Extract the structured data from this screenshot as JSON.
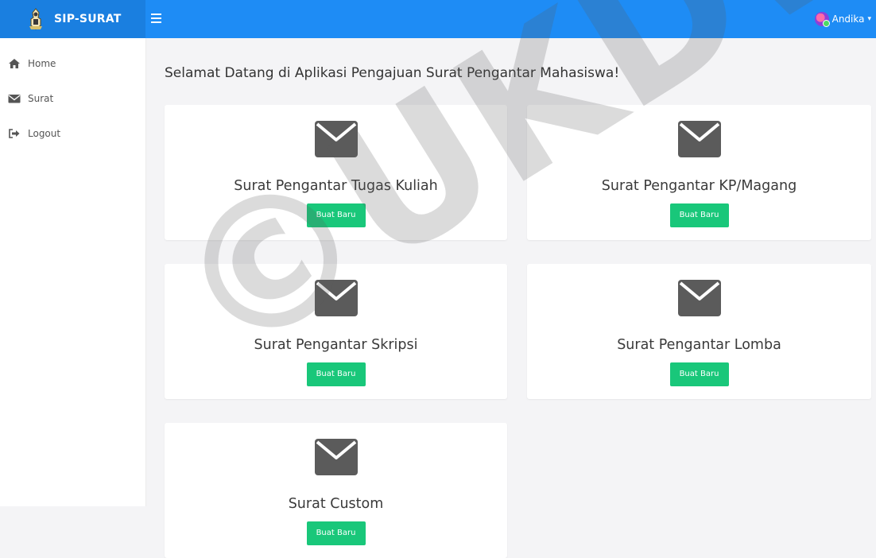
{
  "app": {
    "name": "SIP-SURAT",
    "brand_color": "#1e8cf5"
  },
  "header": {
    "menu_icon": "hamburger-icon",
    "user_name": "Andika"
  },
  "sidebar": {
    "items": [
      {
        "label": "Home",
        "icon": "home-icon"
      },
      {
        "label": "Surat",
        "icon": "envelope-icon"
      },
      {
        "label": "Logout",
        "icon": "logout-icon"
      }
    ]
  },
  "main": {
    "welcome": "Selamat Datang di Aplikasi Pengajuan Surat Pengantar Mahasiswa!",
    "cards": [
      {
        "title": "Surat Pengantar Tugas Kuliah",
        "button": "Buat Baru",
        "icon": "envelope-icon"
      },
      {
        "title": "Surat Pengantar KP/Magang",
        "button": "Buat Baru",
        "icon": "envelope-icon"
      },
      {
        "title": "Surat Pengantar Skripsi",
        "button": "Buat Baru",
        "icon": "envelope-icon"
      },
      {
        "title": "Surat Pengantar Lomba",
        "button": "Buat Baru",
        "icon": "envelope-icon"
      },
      {
        "title": "Surat Custom",
        "button": "Buat Baru",
        "icon": "envelope-icon"
      }
    ],
    "button_color": "#19c77a"
  },
  "watermark": "©UKDW"
}
